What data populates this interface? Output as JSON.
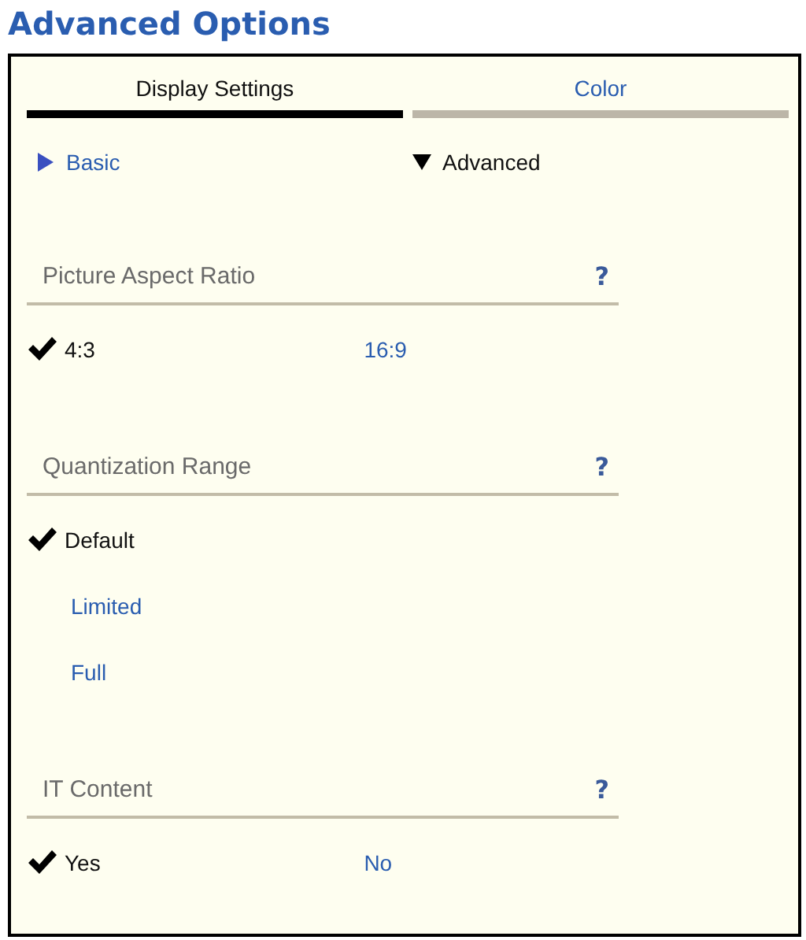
{
  "title": "Advanced Options",
  "tabs": [
    {
      "label": "Display Settings",
      "selected": true
    },
    {
      "label": "Color",
      "selected": false
    }
  ],
  "modes": [
    {
      "label": "Basic",
      "expanded": false
    },
    {
      "label": "Advanced",
      "expanded": true
    }
  ],
  "sections": [
    {
      "title": "Picture Aspect Ratio",
      "help": "?",
      "kind": "row",
      "options": [
        {
          "label": "4:3",
          "selected": true
        },
        {
          "label": "16:9",
          "selected": false
        }
      ]
    },
    {
      "title": "Quantization Range",
      "help": "?",
      "kind": "column",
      "options": [
        {
          "label": "Default",
          "selected": true
        },
        {
          "label": "Limited",
          "selected": false
        },
        {
          "label": "Full",
          "selected": false
        }
      ]
    },
    {
      "title": "IT Content",
      "help": "?",
      "kind": "row",
      "options": [
        {
          "label": "Yes",
          "selected": true
        },
        {
          "label": "No",
          "selected": false
        }
      ]
    }
  ]
}
